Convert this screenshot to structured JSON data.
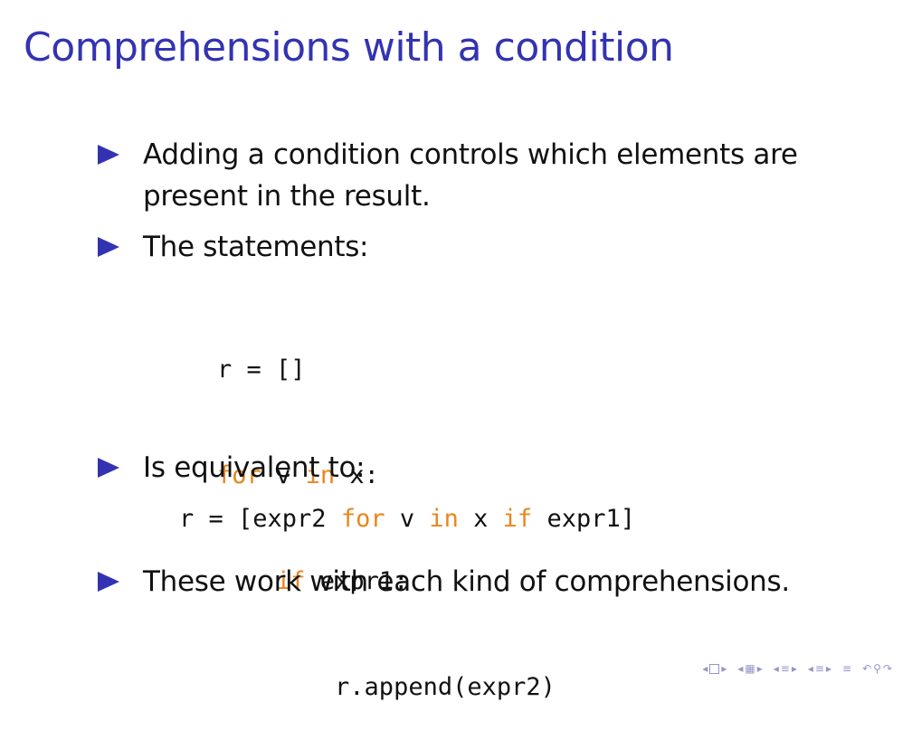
{
  "slide": {
    "title": "Comprehensions with a condition",
    "bullets": [
      {
        "line1": "Adding a condition controls which elements are",
        "line2": "present in the result."
      },
      {
        "line1": "The statements:"
      },
      {
        "line1": "Is equivalent to:"
      },
      {
        "line1": "These work with each kind of comprehensions."
      }
    ],
    "code_block": {
      "line1": "r = []",
      "line2_kw1": "for",
      "line2_a": " v ",
      "line2_kw2": "in",
      "line2_b": " x:",
      "line3_indent": "    ",
      "line3_kw": "if",
      "line3_rest": " expr1:",
      "line4": "        r.append(expr2)"
    },
    "code_inline": {
      "part1": "r = [expr2 ",
      "kw_for": "for",
      "part2": " v ",
      "kw_in": "in",
      "part3": " x ",
      "kw_if": "if",
      "part4": " expr1]"
    }
  },
  "colors": {
    "title": "#3333b2",
    "bullet": "#3333b2",
    "keyword": "#e8871e",
    "nav": "#9696c8"
  },
  "nav_icons": [
    "nav-frame-prev-icon",
    "nav-frame-next-icon",
    "nav-subsection-icon",
    "nav-section-icon",
    "nav-align-icon",
    "nav-search-icon"
  ]
}
